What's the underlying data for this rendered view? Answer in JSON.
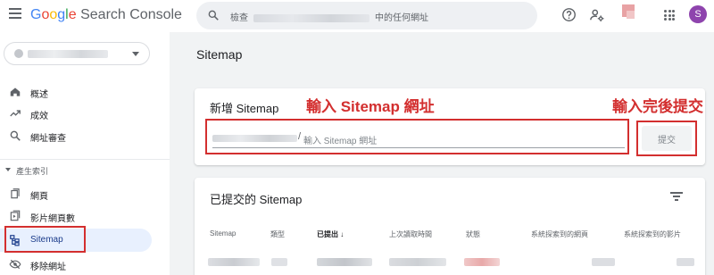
{
  "header": {
    "logo_google": [
      "G",
      "o",
      "o",
      "g",
      "l",
      "e"
    ],
    "logo_rest": "Search Console",
    "search_prefix": "檢查",
    "search_suffix": "中的任何網址",
    "profile_initial": "S"
  },
  "sidebar": {
    "items": [
      {
        "label": "概述",
        "icon": "home-icon"
      },
      {
        "label": "成效",
        "icon": "trending-icon"
      },
      {
        "label": "網址審查",
        "icon": "search-icon"
      }
    ],
    "section_label": "產生索引",
    "index_items": [
      {
        "label": "網頁",
        "icon": "pages-icon"
      },
      {
        "label": "影片網頁數",
        "icon": "video-pages-icon"
      },
      {
        "label": "Sitemap",
        "icon": "sitemap-icon",
        "active": true
      },
      {
        "label": "移除網址",
        "icon": "removals-icon"
      }
    ]
  },
  "main": {
    "page_title": "Sitemap",
    "add_card": {
      "title": "新增 Sitemap",
      "url_slash": "/",
      "url_placeholder": "輸入 Sitemap 網址",
      "submit_label": "提交"
    },
    "annotations": {
      "input_hint": "輸入 Sitemap 網址",
      "submit_hint": "輸入完後提交"
    },
    "list_card": {
      "title": "已提交的 Sitemap",
      "columns": [
        "Sitemap",
        "類型",
        "已提出",
        "上次讀取時間",
        "狀態",
        "系統探索到的網頁",
        "系統探索到的影片"
      ],
      "sorted_column_arrow": "↓"
    }
  },
  "colors": {
    "annotation_red": "#d32f2f",
    "active_nav_bg": "#e8f0fe",
    "avatar": "#8e44ad"
  }
}
